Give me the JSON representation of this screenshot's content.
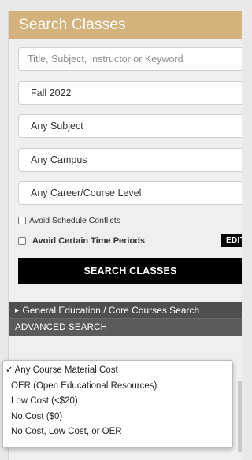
{
  "header": {
    "title": "Search Classes"
  },
  "search": {
    "placeholder": "Title, Subject, Instructor or Keyword",
    "value": ""
  },
  "filters": {
    "term": "Fall 2022",
    "subject": "Any Subject",
    "campus": "Any Campus",
    "career": "Any Career/Course Level"
  },
  "options": {
    "avoid_conflicts_label": "Avoid Schedule Conflicts",
    "avoid_conflicts_checked": false,
    "avoid_periods_label": "Avoid Certain Time Periods",
    "avoid_periods_checked": false,
    "edit_label": "EDIT"
  },
  "search_button": {
    "label": "SEARCH CLASSES"
  },
  "sections": {
    "gen_ed": "General Education / Core Courses Search",
    "advanced": "ADVANCED SEARCH"
  },
  "material_cost_dropdown": {
    "selected_mark": "✓",
    "options": [
      "Any Course Material Cost",
      "OER (Open Educational Resources)",
      "Low Cost (<$20)",
      "No Cost ($0)",
      "No Cost, Low Cost, or OER"
    ],
    "selected_index": 0
  },
  "icons": {
    "chevron": "chevron-down-icon",
    "expand": "triangle-right-icon",
    "check": "checkmark-icon"
  },
  "colors": {
    "header_bg": "#d3b27c",
    "button_bg": "#000000",
    "section_bg": "#4f4f4f"
  }
}
